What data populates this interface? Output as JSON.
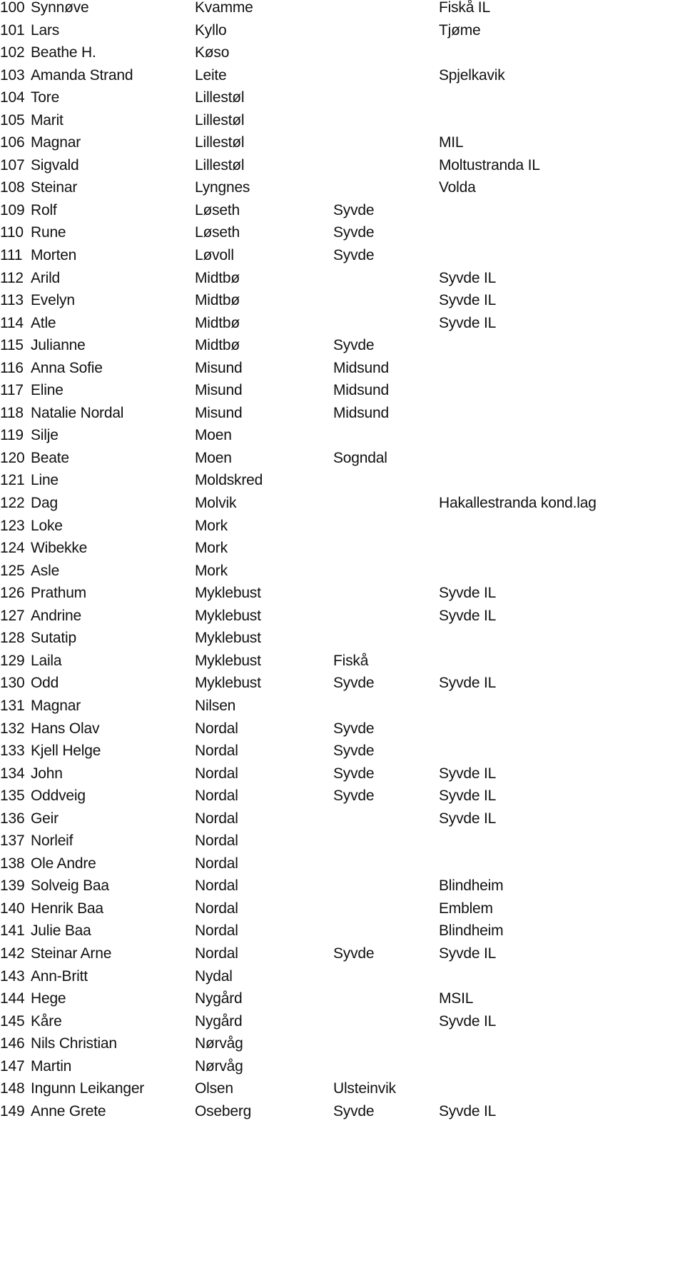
{
  "rows": [
    {
      "num": "100",
      "first": "Synnøve",
      "last": "Kvamme",
      "place": "",
      "club": "Fiskå IL"
    },
    {
      "num": "101",
      "first": "Lars",
      "last": "Kyllo",
      "place": "",
      "club": "Tjøme"
    },
    {
      "num": "102",
      "first": "Beathe H.",
      "last": "Køso",
      "place": "",
      "club": ""
    },
    {
      "num": "103",
      "first": "Amanda Strand",
      "last": "Leite",
      "place": "",
      "club": "Spjelkavik"
    },
    {
      "num": "104",
      "first": "Tore",
      "last": "Lillestøl",
      "place": "",
      "club": ""
    },
    {
      "num": "105",
      "first": "Marit",
      "last": "Lillestøl",
      "place": "",
      "club": ""
    },
    {
      "num": "106",
      "first": "Magnar",
      "last": "Lillestøl",
      "place": "",
      "club": "MIL"
    },
    {
      "num": "107",
      "first": "Sigvald",
      "last": "Lillestøl",
      "place": "",
      "club": "Moltustranda IL"
    },
    {
      "num": "108",
      "first": "Steinar",
      "last": "Lyngnes",
      "place": "",
      "club": "Volda"
    },
    {
      "num": "109",
      "first": "Rolf",
      "last": "Løseth",
      "place": "Syvde",
      "club": ""
    },
    {
      "num": "110",
      "first": "Rune",
      "last": "Løseth",
      "place": "Syvde",
      "club": ""
    },
    {
      "num": "111",
      "first": "Morten",
      "last": "Løvoll",
      "place": "Syvde",
      "club": ""
    },
    {
      "num": "112",
      "first": "Arild",
      "last": "Midtbø",
      "place": "",
      "club": "Syvde IL"
    },
    {
      "num": "113",
      "first": "Evelyn",
      "last": "Midtbø",
      "place": "",
      "club": "Syvde IL"
    },
    {
      "num": "114",
      "first": "Atle",
      "last": "Midtbø",
      "place": "",
      "club": "Syvde IL"
    },
    {
      "num": "115",
      "first": "Julianne",
      "last": "Midtbø",
      "place": "Syvde",
      "club": ""
    },
    {
      "num": "116",
      "first": "Anna Sofie",
      "last": "Misund",
      "place": "Midsund",
      "club": ""
    },
    {
      "num": "117",
      "first": "Eline",
      "last": "Misund",
      "place": "Midsund",
      "club": ""
    },
    {
      "num": "118",
      "first": "Natalie Nordal",
      "last": "Misund",
      "place": "Midsund",
      "club": ""
    },
    {
      "num": "119",
      "first": "Silje",
      "last": "Moen",
      "place": "",
      "club": ""
    },
    {
      "num": "120",
      "first": "Beate",
      "last": "Moen",
      "place": "Sogndal",
      "club": ""
    },
    {
      "num": "121",
      "first": "Line",
      "last": "Moldskred",
      "place": "",
      "club": ""
    },
    {
      "num": "122",
      "first": "Dag",
      "last": "Molvik",
      "place": "",
      "club": "Hakallestranda kond.lag"
    },
    {
      "num": "123",
      "first": "Loke",
      "last": "Mork",
      "place": "",
      "club": ""
    },
    {
      "num": "124",
      "first": "Wibekke",
      "last": "Mork",
      "place": "",
      "club": ""
    },
    {
      "num": "125",
      "first": "Asle",
      "last": "Mork",
      "place": "",
      "club": ""
    },
    {
      "num": "126",
      "first": "Prathum",
      "last": "Myklebust",
      "place": "",
      "club": "Syvde IL"
    },
    {
      "num": "127",
      "first": "Andrine",
      "last": "Myklebust",
      "place": "",
      "club": "Syvde IL"
    },
    {
      "num": "128",
      "first": "Sutatip",
      "last": "Myklebust",
      "place": "",
      "club": ""
    },
    {
      "num": "129",
      "first": "Laila",
      "last": "Myklebust",
      "place": "Fiskå",
      "club": ""
    },
    {
      "num": "130",
      "first": "Odd",
      "last": "Myklebust",
      "place": "Syvde",
      "club": "Syvde IL"
    },
    {
      "num": "131",
      "first": "Magnar",
      "last": "Nilsen",
      "place": "",
      "club": ""
    },
    {
      "num": "132",
      "first": "Hans Olav",
      "last": "Nordal",
      "place": "Syvde",
      "club": ""
    },
    {
      "num": "133",
      "first": "Kjell Helge",
      "last": "Nordal",
      "place": "Syvde",
      "club": ""
    },
    {
      "num": "134",
      "first": "John",
      "last": "Nordal",
      "place": "Syvde",
      "club": "Syvde IL"
    },
    {
      "num": "135",
      "first": "Oddveig",
      "last": "Nordal",
      "place": "Syvde",
      "club": "Syvde IL"
    },
    {
      "num": "136",
      "first": "Geir",
      "last": "Nordal",
      "place": "",
      "club": "Syvde IL"
    },
    {
      "num": "137",
      "first": "Norleif",
      "last": "Nordal",
      "place": "",
      "club": ""
    },
    {
      "num": "138",
      "first": "Ole Andre",
      "last": "Nordal",
      "place": "",
      "club": ""
    },
    {
      "num": "139",
      "first": "Solveig Baa",
      "last": "Nordal",
      "place": "",
      "club": "Blindheim"
    },
    {
      "num": "140",
      "first": "Henrik Baa",
      "last": "Nordal",
      "place": "",
      "club": "Emblem"
    },
    {
      "num": "141",
      "first": "Julie Baa",
      "last": "Nordal",
      "place": "",
      "club": "Blindheim"
    },
    {
      "num": "142",
      "first": "Steinar Arne",
      "last": "Nordal",
      "place": "Syvde",
      "club": "Syvde IL"
    },
    {
      "num": "143",
      "first": "Ann-Britt",
      "last": "Nydal",
      "place": "",
      "club": ""
    },
    {
      "num": "144",
      "first": "Hege",
      "last": "Nygård",
      "place": "",
      "club": "MSIL"
    },
    {
      "num": "145",
      "first": "Kåre",
      "last": "Nygård",
      "place": "",
      "club": "Syvde IL"
    },
    {
      "num": "146",
      "first": "Nils Christian",
      "last": "Nørvåg",
      "place": "",
      "club": ""
    },
    {
      "num": "147",
      "first": "Martin",
      "last": "Nørvåg",
      "place": "",
      "club": ""
    },
    {
      "num": "148",
      "first": "Ingunn Leikanger",
      "last": "Olsen",
      "place": "Ulsteinvik",
      "club": ""
    },
    {
      "num": "149",
      "first": "Anne Grete",
      "last": "Oseberg",
      "place": "Syvde",
      "club": "Syvde IL"
    }
  ]
}
